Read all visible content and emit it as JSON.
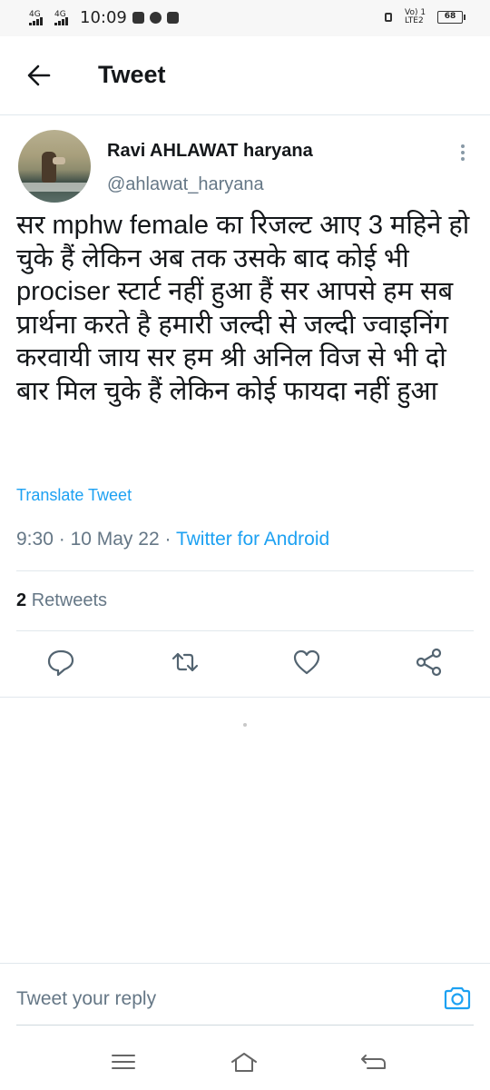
{
  "status_bar": {
    "network_1": "4G",
    "network_2": "4G",
    "time": "10:09",
    "volte_label": "Vo) 1 LTE2",
    "battery": "68"
  },
  "app_bar": {
    "title": "Tweet",
    "back_icon": "arrow-left-icon"
  },
  "tweet": {
    "author_name": "Ravi AHLAWAT haryana",
    "author_handle": "@ahlawat_haryana",
    "text": "सर mphw female का रिजल्ट आए 3 महिने  हो चुके हैं लेकिन अब तक उसके बाद कोई भी prociser स्टार्ट नहीं हुआ हैं सर आपसे हम सब प्रार्थना करते है हमारी जल्दी से जल्दी ज्वाइनिंग करवायी जाय सर हम श्री अनिल विज से भी दो बार मिल चुके हैं लेकिन कोई फायदा नहीं हुआ",
    "translate_label": "Translate Tweet",
    "time": "9:30",
    "separator": "·",
    "date": "10 May 22",
    "source": "Twitter for Android",
    "retweet_count": "2",
    "retweet_label": "Retweets"
  },
  "actions": {
    "reply_icon": "reply-icon",
    "retweet_icon": "retweet-icon",
    "like_icon": "heart-icon",
    "share_icon": "share-icon"
  },
  "reply_bar": {
    "placeholder": "Tweet your reply",
    "camera_icon": "camera-icon"
  },
  "colors": {
    "accent": "#1da1f2",
    "text_primary": "#14171a",
    "text_secondary": "#657786",
    "divider": "#e1e8ed"
  }
}
